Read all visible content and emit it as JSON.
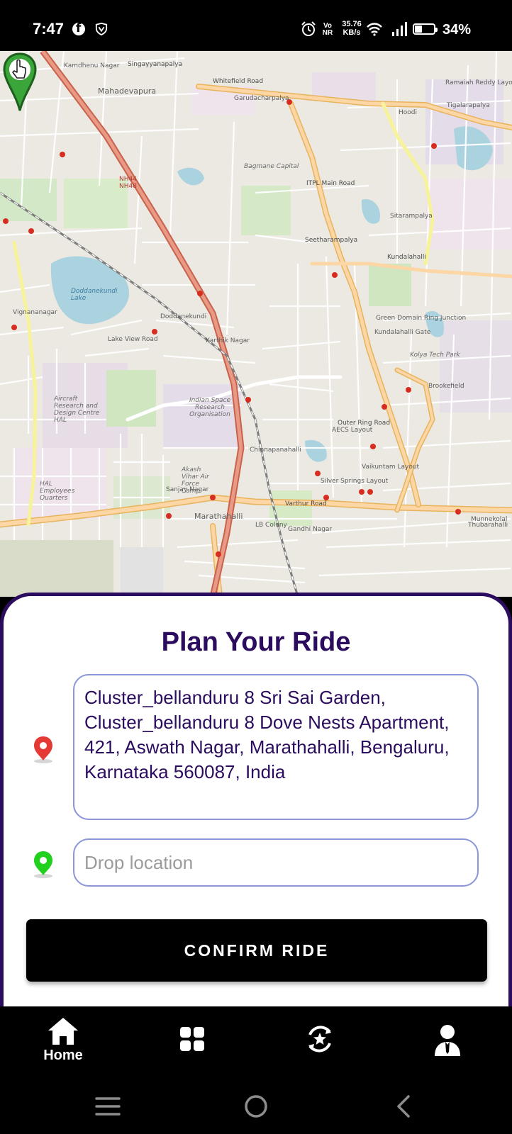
{
  "status_bar": {
    "time": "7:47",
    "network_badge": "Vo NR",
    "speed_value": "35.76",
    "speed_unit": "KB/s",
    "battery": "34%",
    "icons": [
      "facebook-icon",
      "vpn-shield-icon",
      "alarm-icon",
      "wifi-icon",
      "signal-icon",
      "battery-icon"
    ]
  },
  "map": {
    "labels": [
      "Kamdhenu Nagar",
      "Mahadevapura",
      "Singayyanapalya",
      "Whitefield Road",
      "Garudacharpalya",
      "Hoodi",
      "Ramaiah Reddy Layout",
      "Tigalarapalya",
      "Kundalahalli",
      "Seetharampalya",
      "Chinnapanahalli",
      "Doddanekundi",
      "Karthik Nagar",
      "Indian Space Research Organisation",
      "Marathahalli",
      "Varthur Road",
      "Brookefield",
      "Vignananagar",
      "Aircraft Research and Design Centre HAL",
      "HAL Employees Quarters",
      "Doddanekundi Lake",
      "Green Domain Ring Junction",
      "Kundalahalli Gate",
      "Outer Ring Road",
      "Sanjay Nagar",
      "Gandhi Nagar",
      "Silver Springs Layout",
      "AECS Layout",
      "Vaikuntam Layout",
      "Thubarahalli",
      "Munnekolal",
      "LB Colony",
      "ITPL Main Road",
      "Sitarampalya",
      "Kolya Tech Park",
      "Lake View Road",
      "Akash Vihar Air Force Camp",
      "NH44",
      "NH48",
      "Bagmane Capital"
    ]
  },
  "sheet": {
    "title": "Plan Your Ride",
    "pickup_value": "Cluster_bellanduru 8 Sri Sai Garden, Cluster_bellanduru 8 Dove Nests Apartment, 421, Aswath Nagar, Marathahalli, Bengaluru, Karnataka 560087, India",
    "drop_placeholder": "Drop location",
    "confirm_label": "CONFIRM RIDE",
    "colors": {
      "accent": "#2c0c5e",
      "field_border": "#8a96d6",
      "pickup_pin": "#e53935",
      "drop_pin": "#22d11d"
    }
  },
  "nav": {
    "home_label": "Home",
    "items": [
      "home-icon",
      "apps-icon",
      "history-icon",
      "profile-icon"
    ]
  }
}
